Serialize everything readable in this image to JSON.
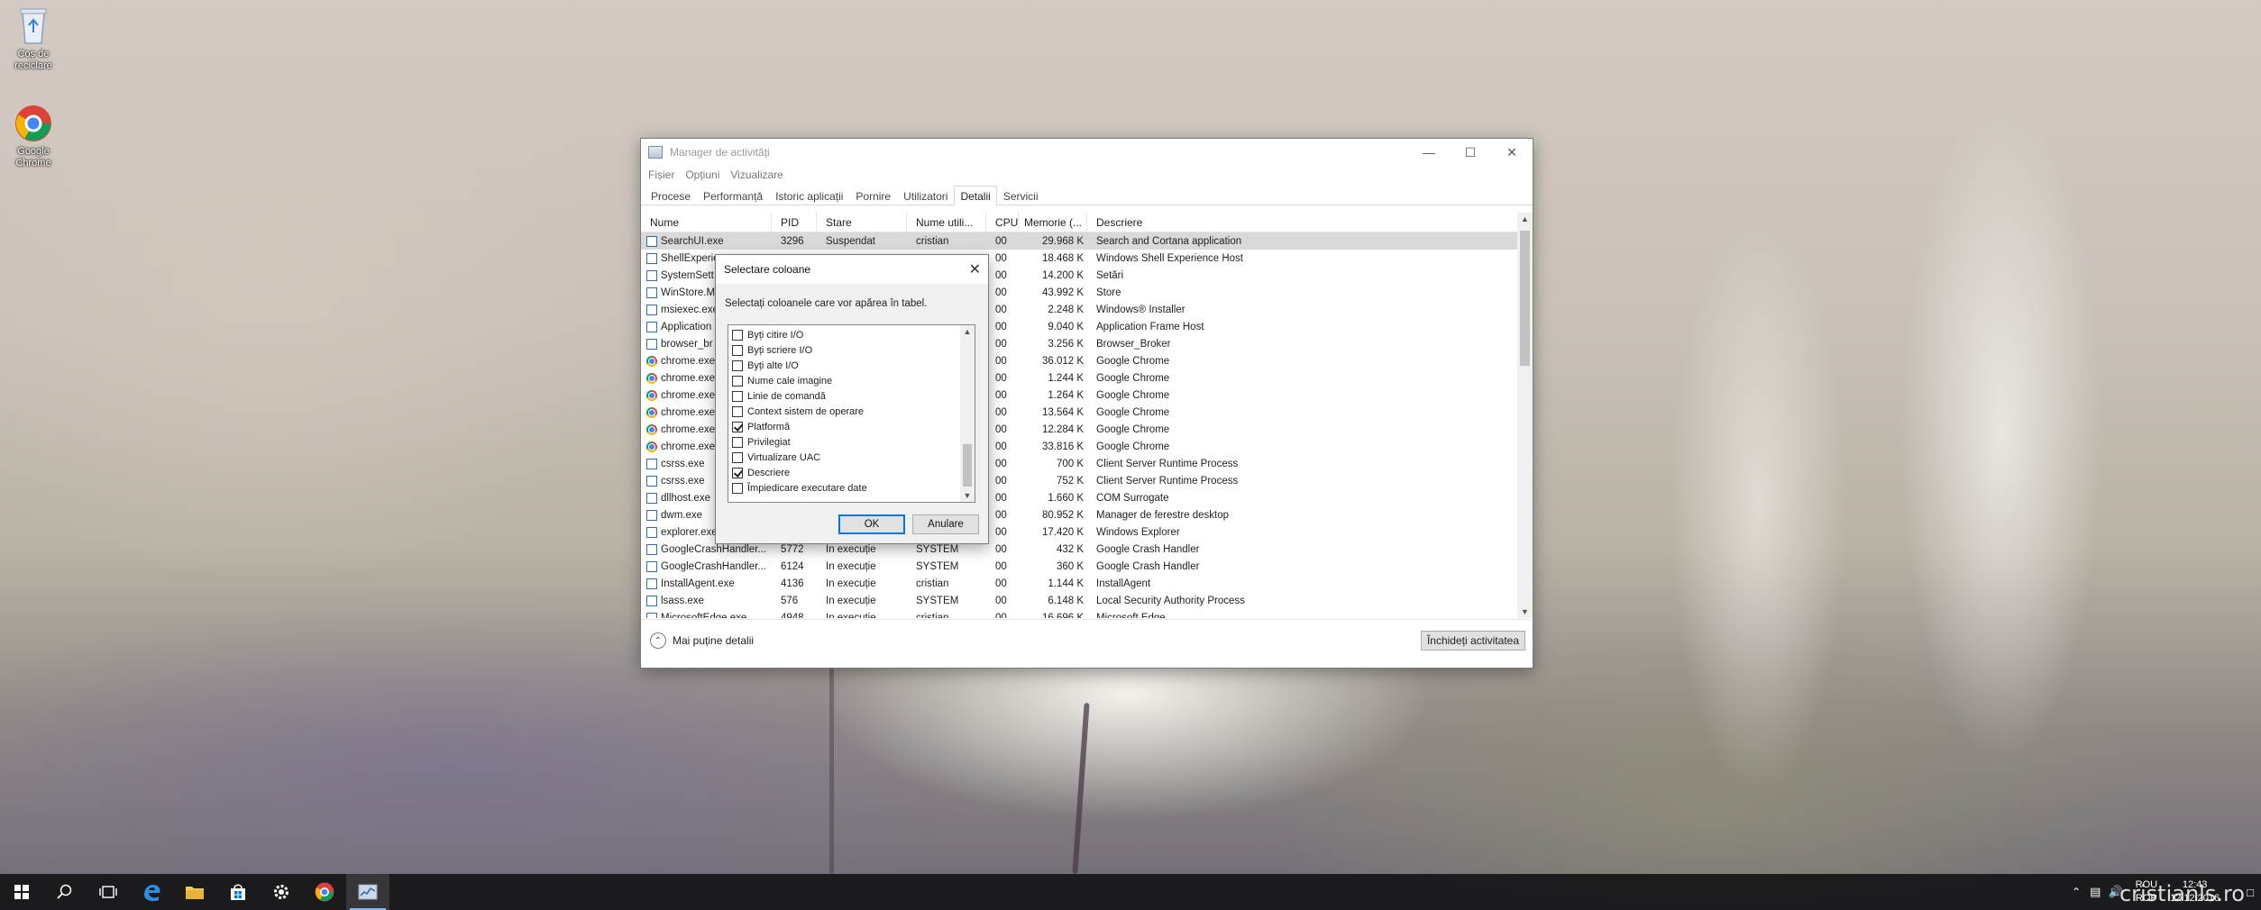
{
  "desktop": {
    "icons": [
      {
        "label": "Coș de reciclare"
      },
      {
        "label": "Google Chrome"
      }
    ]
  },
  "window": {
    "title": "Manager de activități",
    "menu": [
      "Fișier",
      "Opțiuni",
      "Vizualizare"
    ],
    "tabs": [
      "Procese",
      "Performanță",
      "Istoric aplicații",
      "Pornire",
      "Utilizatori",
      "Detalii",
      "Servicii"
    ],
    "active_tab": "Detalii",
    "columns": [
      "Nume",
      "PID",
      "Stare",
      "Nume utili...",
      "CPU",
      "Memorie (...",
      "Descriere"
    ],
    "rows": [
      {
        "name": "SearchUI.exe",
        "pid": "3296",
        "state": "Suspendat",
        "user": "cristian",
        "cpu": "00",
        "mem": "29.968 K",
        "desc": "Search and Cortana application",
        "icon": "app-icon"
      },
      {
        "name": "ShellExperie",
        "pid": "",
        "state": "",
        "user": "",
        "cpu": "00",
        "mem": "18.468 K",
        "desc": "Windows Shell Experience Host",
        "icon": "app-icon"
      },
      {
        "name": "SystemSett",
        "pid": "",
        "state": "",
        "user": "",
        "cpu": "00",
        "mem": "14.200 K",
        "desc": "Setări",
        "icon": "settings-icon"
      },
      {
        "name": "WinStore.M",
        "pid": "",
        "state": "",
        "user": "",
        "cpu": "00",
        "mem": "43.992 K",
        "desc": "Store",
        "icon": "app-icon"
      },
      {
        "name": "msiexec.exe",
        "pid": "",
        "state": "",
        "user": "",
        "cpu": "00",
        "mem": "2.248 K",
        "desc": "Windows® Installer",
        "icon": "installer-icon"
      },
      {
        "name": "Application",
        "pid": "",
        "state": "",
        "user": "",
        "cpu": "00",
        "mem": "9.040 K",
        "desc": "Application Frame Host",
        "icon": "app-icon"
      },
      {
        "name": "browser_br",
        "pid": "",
        "state": "",
        "user": "",
        "cpu": "00",
        "mem": "3.256 K",
        "desc": "Browser_Broker",
        "icon": "app-icon"
      },
      {
        "name": "chrome.exe",
        "pid": "",
        "state": "",
        "user": "",
        "cpu": "00",
        "mem": "36.012 K",
        "desc": "Google Chrome",
        "icon": "chrome-icon"
      },
      {
        "name": "chrome.exe",
        "pid": "",
        "state": "",
        "user": "",
        "cpu": "00",
        "mem": "1.244 K",
        "desc": "Google Chrome",
        "icon": "chrome-icon"
      },
      {
        "name": "chrome.exe",
        "pid": "",
        "state": "",
        "user": "",
        "cpu": "00",
        "mem": "1.264 K",
        "desc": "Google Chrome",
        "icon": "chrome-icon"
      },
      {
        "name": "chrome.exe",
        "pid": "",
        "state": "",
        "user": "",
        "cpu": "00",
        "mem": "13.564 K",
        "desc": "Google Chrome",
        "icon": "chrome-icon"
      },
      {
        "name": "chrome.exe",
        "pid": "",
        "state": "",
        "user": "",
        "cpu": "00",
        "mem": "12.284 K",
        "desc": "Google Chrome",
        "icon": "chrome-icon"
      },
      {
        "name": "chrome.exe",
        "pid": "",
        "state": "",
        "user": "",
        "cpu": "00",
        "mem": "33.816 K",
        "desc": "Google Chrome",
        "icon": "chrome-icon"
      },
      {
        "name": "csrss.exe",
        "pid": "",
        "state": "",
        "user": "",
        "cpu": "00",
        "mem": "700 K",
        "desc": "Client Server Runtime Process",
        "icon": "app-icon"
      },
      {
        "name": "csrss.exe",
        "pid": "",
        "state": "",
        "user": "",
        "cpu": "00",
        "mem": "752 K",
        "desc": "Client Server Runtime Process",
        "icon": "app-icon"
      },
      {
        "name": "dllhost.exe",
        "pid": "",
        "state": "",
        "user": "",
        "cpu": "00",
        "mem": "1.660 K",
        "desc": "COM Surrogate",
        "icon": "app-icon"
      },
      {
        "name": "dwm.exe",
        "pid": "",
        "state": "",
        "user": "",
        "cpu": "00",
        "mem": "80.952 K",
        "desc": "Manager de ferestre desktop",
        "icon": "app-icon"
      },
      {
        "name": "explorer.exe",
        "pid": "",
        "state": "",
        "user": "",
        "cpu": "00",
        "mem": "17.420 K",
        "desc": "Windows Explorer",
        "icon": "folder-icon"
      },
      {
        "name": "GoogleCrashHandler...",
        "pid": "5772",
        "state": "În execuție",
        "user": "SYSTEM",
        "cpu": "00",
        "mem": "432 K",
        "desc": "Google Crash Handler",
        "icon": "app-icon"
      },
      {
        "name": "GoogleCrashHandler...",
        "pid": "6124",
        "state": "În execuție",
        "user": "SYSTEM",
        "cpu": "00",
        "mem": "360 K",
        "desc": "Google Crash Handler",
        "icon": "app-icon"
      },
      {
        "name": "InstallAgent.exe",
        "pid": "4136",
        "state": "În execuție",
        "user": "cristian",
        "cpu": "00",
        "mem": "1.144 K",
        "desc": "InstallAgent",
        "icon": "app-icon"
      },
      {
        "name": "lsass.exe",
        "pid": "576",
        "state": "În execuție",
        "user": "SYSTEM",
        "cpu": "00",
        "mem": "6.148 K",
        "desc": "Local Security Authority Process",
        "icon": "app-icon"
      },
      {
        "name": "MicrosoftEdge.exe",
        "pid": "4948",
        "state": "În execuție",
        "user": "cristian",
        "cpu": "00",
        "mem": "16.696 K",
        "desc": "Microsoft Edge",
        "icon": "edge-icon"
      }
    ],
    "less_details": "Mai puține detalii",
    "end_task": "Închideți activitatea"
  },
  "dialog": {
    "title": "Selectare coloane",
    "message": "Selectați coloanele care vor apărea în tabel.",
    "options": [
      {
        "label": "Byți citire I/O",
        "checked": false
      },
      {
        "label": "Byți scriere I/O",
        "checked": false
      },
      {
        "label": "Byți alte I/O",
        "checked": false
      },
      {
        "label": "Nume cale imagine",
        "checked": false
      },
      {
        "label": "Linie de comandă",
        "checked": false
      },
      {
        "label": "Context sistem de operare",
        "checked": false
      },
      {
        "label": "Platformă",
        "checked": true
      },
      {
        "label": "Privilegiat",
        "checked": false
      },
      {
        "label": "Virtualizare UAC",
        "checked": false
      },
      {
        "label": "Descriere",
        "checked": true
      },
      {
        "label": "Împiedicare executare date",
        "checked": false
      }
    ],
    "ok": "OK",
    "cancel": "Anulare"
  },
  "taskbar": {
    "items": [
      "windows-start-icon",
      "search-icon",
      "task-view-icon",
      "edge-icon",
      "file-explorer-icon",
      "store-icon",
      "settings-icon",
      "chrome-icon",
      "task-manager-icon"
    ],
    "lang_top": "ROU",
    "lang_bottom": "ROP",
    "time": "12:43",
    "date": "12.12.2016"
  },
  "watermark": "cristianls.ro",
  "colors": {
    "accent": "#0078d7",
    "selected_row": "#d9d9d9",
    "taskbar": "#141416"
  }
}
